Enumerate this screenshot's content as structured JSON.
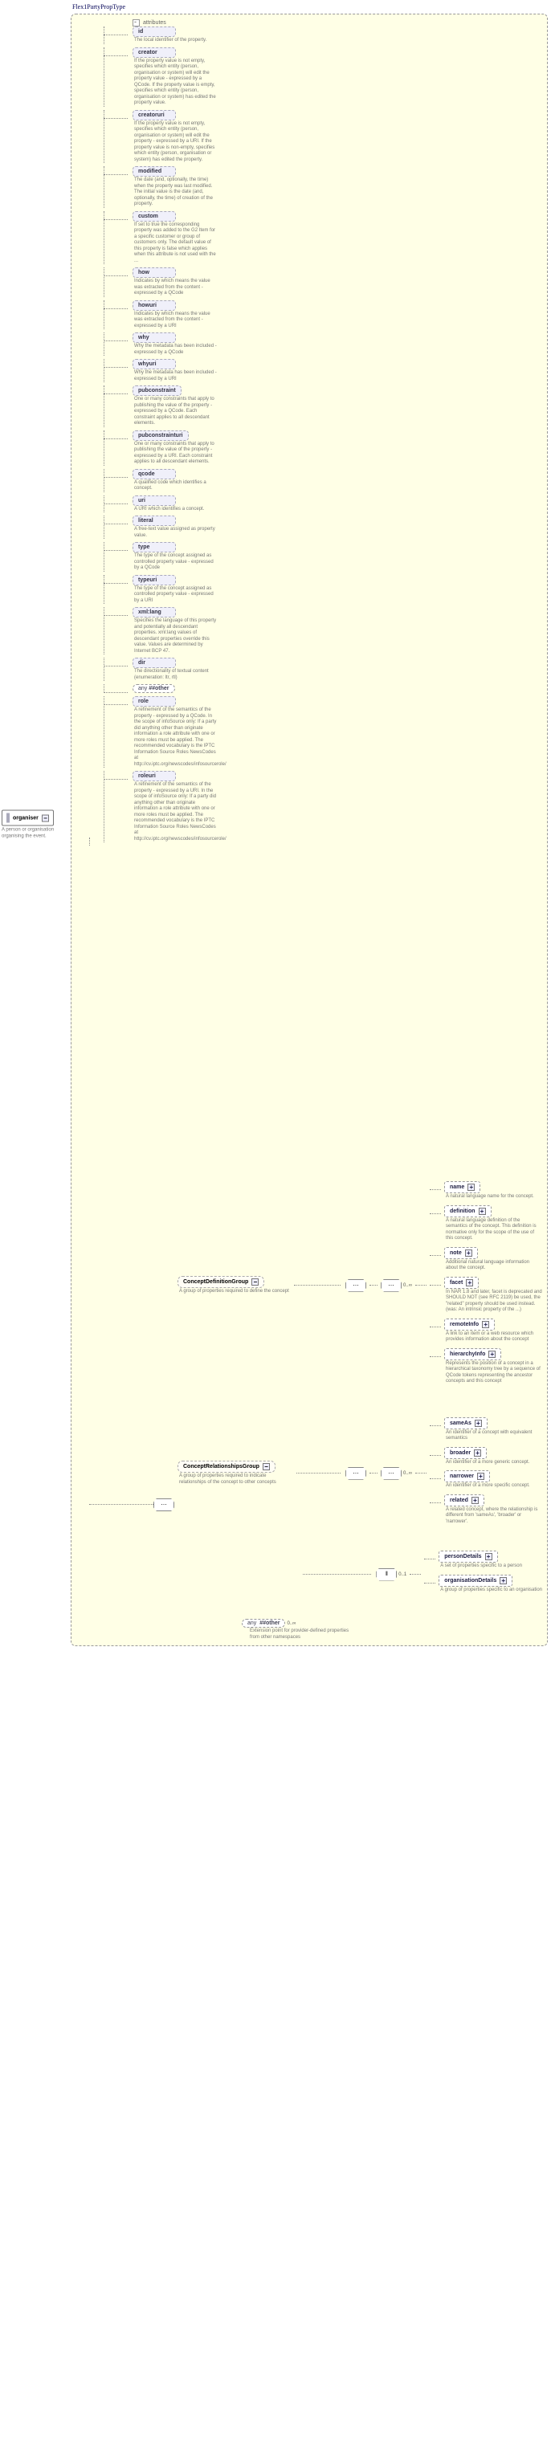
{
  "root": {
    "label": "organiser",
    "desc": "A person or organisation organising the event."
  },
  "typeTitle": "Flex1PartyPropType",
  "attrs": {
    "id": {
      "name": "id",
      "desc": "The local identifier of the property."
    },
    "creator": {
      "name": "creator",
      "desc": "If the property value is not empty, specifies which entity (person, organisation or system) will edit the property value - expressed by a QCode. If the property value is empty, specifies which entity (person, organisation or system) has edited the property value."
    },
    "creatoruri": {
      "name": "creatoruri",
      "desc": "If the property value is not empty, specifies which entity (person, organisation or system) will edit the property - expressed by a URI. If the property value is non-empty, specifies which entity (person, organisation or system) has edited the property."
    },
    "modified": {
      "name": "modified",
      "desc": "The date (and, optionally, the time) when the property was last modified. The initial value is the date (and, optionally, the time) of creation of the property."
    },
    "custom": {
      "name": "custom",
      "desc": "If set to true the corresponding property was added to the G2 Item for a specific customer or group of customers only. The default value of this property is false which applies when this attribute is not used with the ..."
    },
    "how": {
      "name": "how",
      "desc": "Indicates by which means the value was extracted from the content - expressed by a QCode"
    },
    "howuri": {
      "name": "howuri",
      "desc": "Indicates by which means the value was extracted from the content - expressed by a URI"
    },
    "why": {
      "name": "why",
      "desc": "Why the metadata has been included - expressed by a QCode"
    },
    "whyuri": {
      "name": "whyuri",
      "desc": "Why the metadata has been included - expressed by a URI"
    },
    "pubconstraint": {
      "name": "pubconstraint",
      "desc": "One or many constraints that apply to publishing the value of the property - expressed by a QCode. Each constraint applies to all descendant elements."
    },
    "pubconstrainturi": {
      "name": "pubconstrainturi",
      "desc": "One or many constraints that apply to publishing the value of the property - expressed by a URI. Each constraint applies to all descendant elements."
    },
    "qcode": {
      "name": "qcode",
      "desc": "A qualified code which identifies a concept."
    },
    "uri": {
      "name": "uri",
      "desc": "A URI which identifies a concept."
    },
    "literal": {
      "name": "literal",
      "desc": "A free-text value assigned as property value."
    },
    "type": {
      "name": "type",
      "desc": "The type of the concept assigned as controlled property value - expressed by a QCode"
    },
    "typeuri": {
      "name": "typeuri",
      "desc": "The type of the concept assigned as controlled property value - expressed by a URI"
    },
    "xmllang": {
      "name": "xml:lang",
      "desc": "Specifies the language of this property and potentially all descendant properties. xml:lang values of descendant properties override this value. Values are determined by Internet BCP 47."
    },
    "dir": {
      "name": "dir",
      "desc": "The directionality of textual content (enumeration: ltr, rtl)"
    },
    "anyOther": {
      "name": "##other",
      "desc": ""
    },
    "role": {
      "name": "role",
      "desc": "A refinement of the semantics of the property - expressed by a QCode. In the scope of infoSource only: If a party did anything other than originate information a role attribute with one or more roles must be applied. The recommended vocabulary is the IPTC Information Source Roles NewsCodes at http://cv.iptc.org/newscodes/infosourcerole/"
    },
    "roleuri": {
      "name": "roleuri",
      "desc": "A refinement of the semantics of the property - expressed by a URI. In the scope of infoSource only: If a party did anything other than originate information a role attribute with one or more roles must be applied. The recommended vocabulary is the IPTC Information Source Roles NewsCodes at http://cv.iptc.org/newscodes/infosourcerole/"
    }
  },
  "elems": {
    "name": {
      "name": "name",
      "desc": "A natural language name for the concept."
    },
    "definition": {
      "name": "definition",
      "desc": "A natural language definition of the semantics of the concept. This definition is normative only for the scope of the use of this concept."
    },
    "note": {
      "name": "note",
      "desc": "Additional natural language information about the concept."
    },
    "facet": {
      "name": "facet",
      "desc": "In NAR 1.8 and later, facet is deprecated and SHOULD NOT (see RFC 2119) be used, the \"related\" property should be used instead.(was: An intrinsic property of the ...)"
    },
    "remoteInfo": {
      "name": "remoteInfo",
      "desc": "A link to an item or a web resource which provides information about the concept"
    },
    "hierarchyInfo": {
      "name": "hierarchyInfo",
      "desc": "Represents the position of a concept in a hierarchical taxonomy tree by a sequence of QCode tokens representing the ancestor concepts and this concept"
    },
    "sameAs": {
      "name": "sameAs",
      "desc": "An identifier of a concept with equivalent semantics"
    },
    "broader": {
      "name": "broader",
      "desc": "An identifier of a more generic concept."
    },
    "narrower": {
      "name": "narrower",
      "desc": "An identifier of a more specific concept."
    },
    "related": {
      "name": "related",
      "desc": "A related concept, where the relationship is different from 'sameAs', 'broader' or 'narrower'."
    },
    "personDetails": {
      "name": "personDetails",
      "desc": "A set of properties specific to a person"
    },
    "organisationDetails": {
      "name": "organisationDetails",
      "desc": "A group of properties specific to an organisation"
    },
    "anyOther": {
      "name": "##other",
      "desc": "Extension point for provider-defined properties from other namespaces"
    }
  },
  "groups": {
    "def": {
      "name": "ConceptDefinitionGroup",
      "desc": "A group of properties required to define the concept"
    },
    "rel": {
      "name": "ConceptRelationshipsGroup",
      "desc": "A group of properties required to indicate relationships of the concept to other concepts"
    }
  },
  "cards": {
    "seq": "0..∞",
    "choice01": "0..1",
    "any_star": "any"
  },
  "attributesLabel": "attributes",
  "anyLabel": "any"
}
